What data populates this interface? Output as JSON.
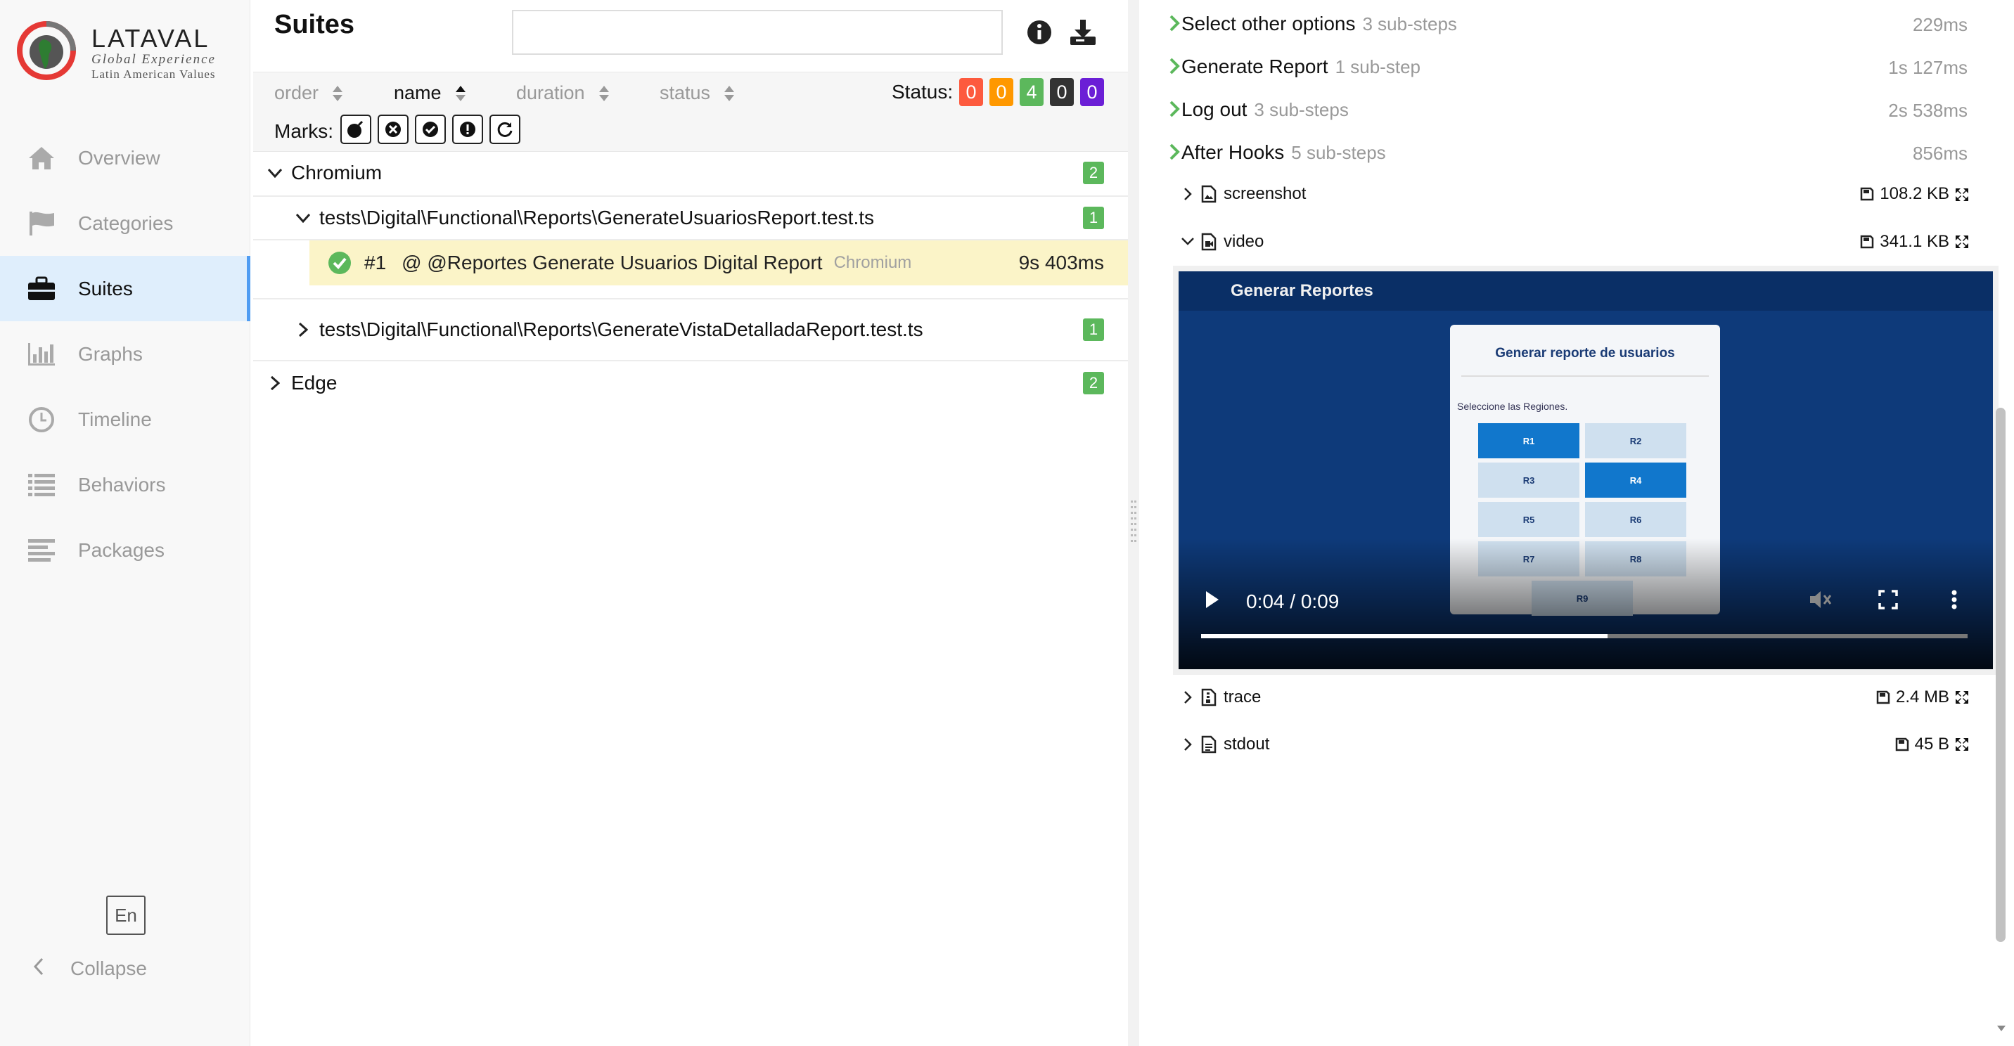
{
  "app": {
    "logo": {
      "brand": "LATAVAL",
      "tagline1": "Global Experience",
      "tagline2": "Latin American Values"
    }
  },
  "sidebar": {
    "items": [
      {
        "label": "Overview",
        "icon": "home-icon"
      },
      {
        "label": "Categories",
        "icon": "flag-icon"
      },
      {
        "label": "Suites",
        "icon": "briefcase-icon",
        "active": true
      },
      {
        "label": "Graphs",
        "icon": "bar-chart-icon"
      },
      {
        "label": "Timeline",
        "icon": "clock-icon"
      },
      {
        "label": "Behaviors",
        "icon": "list-icon"
      },
      {
        "label": "Packages",
        "icon": "align-left-icon"
      }
    ],
    "language": "En",
    "collapse_label": "Collapse"
  },
  "suites": {
    "title": "Suites",
    "search": {
      "value": "",
      "placeholder": ""
    },
    "sort": {
      "order": "order",
      "name": "name",
      "duration": "duration",
      "status": "status"
    },
    "status_label": "Status:",
    "status_counts": [
      {
        "value": "0",
        "color": "#fd5a3e"
      },
      {
        "value": "0",
        "color": "#ff9800"
      },
      {
        "value": "4",
        "color": "#5cb85c"
      },
      {
        "value": "0",
        "color": "#333333"
      },
      {
        "value": "0",
        "color": "#6b1fd6"
      }
    ],
    "marks_label": "Marks:",
    "tree": {
      "chromium": {
        "label": "Chromium",
        "count": "2"
      },
      "file1": {
        "label": "tests\\Digital\\Functional\\Reports\\GenerateUsuariosReport.test.ts",
        "count": "1"
      },
      "test1": {
        "num": "#1",
        "name": "@ @Reportes Generate Usuarios Digital Report",
        "browser": "Chromium",
        "duration": "9s 403ms"
      },
      "file2": {
        "label": "tests\\Digital\\Functional\\Reports\\GenerateVistaDetalladaReport.test.ts",
        "count": "1"
      },
      "edge": {
        "label": "Edge",
        "count": "2"
      }
    }
  },
  "details": {
    "steps": [
      {
        "name": "Select other options",
        "sub": "3 sub-steps",
        "duration": "229ms"
      },
      {
        "name": "Generate Report",
        "sub": "1 sub-step",
        "duration": "1s 127ms"
      },
      {
        "name": "Log out",
        "sub": "3 sub-steps",
        "duration": "2s 538ms"
      },
      {
        "name": "After Hooks",
        "sub": "5 sub-steps",
        "duration": "856ms"
      }
    ],
    "attachments": [
      {
        "name": "screenshot",
        "size": "108.2 KB"
      },
      {
        "name": "video",
        "size": "341.1 KB"
      },
      {
        "name": "trace",
        "size": "2.4 MB"
      },
      {
        "name": "stdout",
        "size": "45 B"
      }
    ],
    "video": {
      "header": "Generar Reportes",
      "card_title": "Generar reporte de usuarios",
      "card_sub": "Seleccione las Regiones.",
      "regions": [
        "R1",
        "R2",
        "R3",
        "R4",
        "R5",
        "R6",
        "R7",
        "R8",
        "R9"
      ],
      "selected": [
        "R1",
        "R4"
      ],
      "time": "0:04 / 0:09",
      "progress": 0.53
    }
  }
}
